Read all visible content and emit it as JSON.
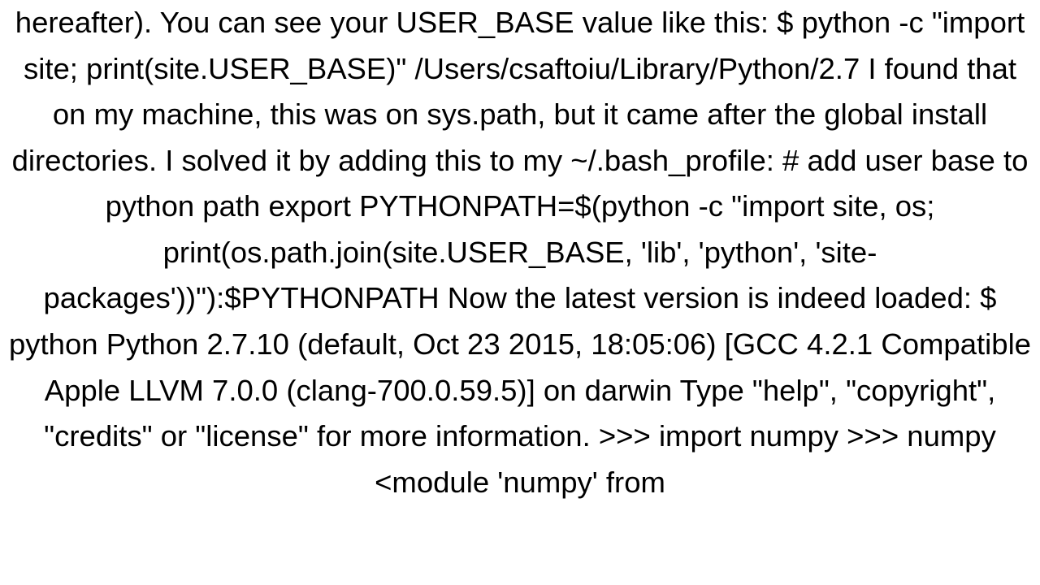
{
  "document": {
    "body_text": "hereafter).  You can see your USER_BASE value like this: $ python -c \"import site; print(site.USER_BASE)\" /Users/csaftoiu/Library/Python/2.7  I found that on my machine, this was on sys.path, but it came after the global install directories. I solved it by adding this to my ~/.bash_profile: # add user base to python path export PYTHONPATH=$(python -c \"import site, os; print(os.path.join(site.USER_BASE, 'lib', 'python', 'site-packages'))\"):$PYTHONPATH  Now the latest version is indeed loaded: $ python Python 2.7.10 (default, Oct 23 2015, 18:05:06) [GCC 4.2.1 Compatible Apple LLVM 7.0.0 (clang-700.0.59.5)] on darwin Type \"help\", \"copyright\", \"credits\" or \"license\" for more information. >>> import numpy >>> numpy <module 'numpy' from"
  }
}
